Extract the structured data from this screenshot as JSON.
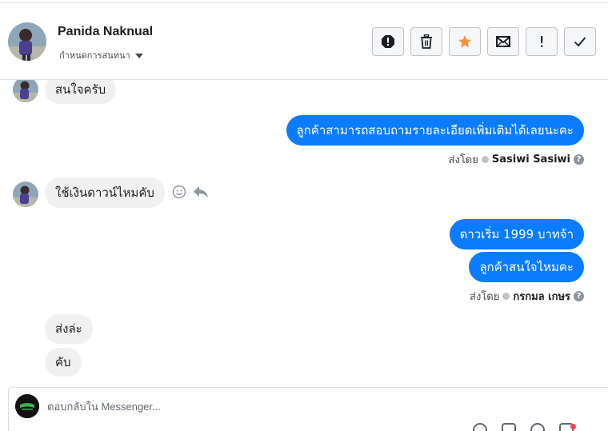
{
  "header": {
    "contact_name": "Panida Naknual",
    "assign_label": "กำหนดการสนทนา",
    "actions": [
      {
        "name": "report-spam-button",
        "icon": "alert-circle-icon"
      },
      {
        "name": "delete-button",
        "icon": "trash-icon"
      },
      {
        "name": "star-button",
        "icon": "star-icon"
      },
      {
        "name": "mark-unread-button",
        "icon": "envelope-icon"
      },
      {
        "name": "follow-up-button",
        "icon": "exclamation-icon"
      },
      {
        "name": "mark-done-button",
        "icon": "checkmark-icon"
      }
    ]
  },
  "messages": {
    "in_1": "สนใจครับ",
    "out_1": "ลูกค้าสามารถสอบถามรายละเอียดเพิ่มเติมได้เลยนะคะ",
    "sent_by_label_1": "ส่งโดย",
    "sent_by_name_1": "Sasiwi Sasiwi",
    "in_2": "ใช้เงินดาวน์ไหมคับ",
    "out_2": "ดาวเริ่ม 1999 บาทจ้า",
    "out_3": "ลูกค้าสนใจไหมคะ",
    "sent_by_label_2": "ส่งโดย",
    "sent_by_name_2": "กรกมล เกษร",
    "in_3": "ส่งล่ะ",
    "in_4": "คับ"
  },
  "composer": {
    "placeholder": "ตอบกลับใน Messenger..."
  },
  "colors": {
    "outgoing_bubble": "#0a7cff",
    "incoming_bubble": "#f0f0f0",
    "star_accent": "#f7923b",
    "notification_dot": "#fa3e5b"
  }
}
